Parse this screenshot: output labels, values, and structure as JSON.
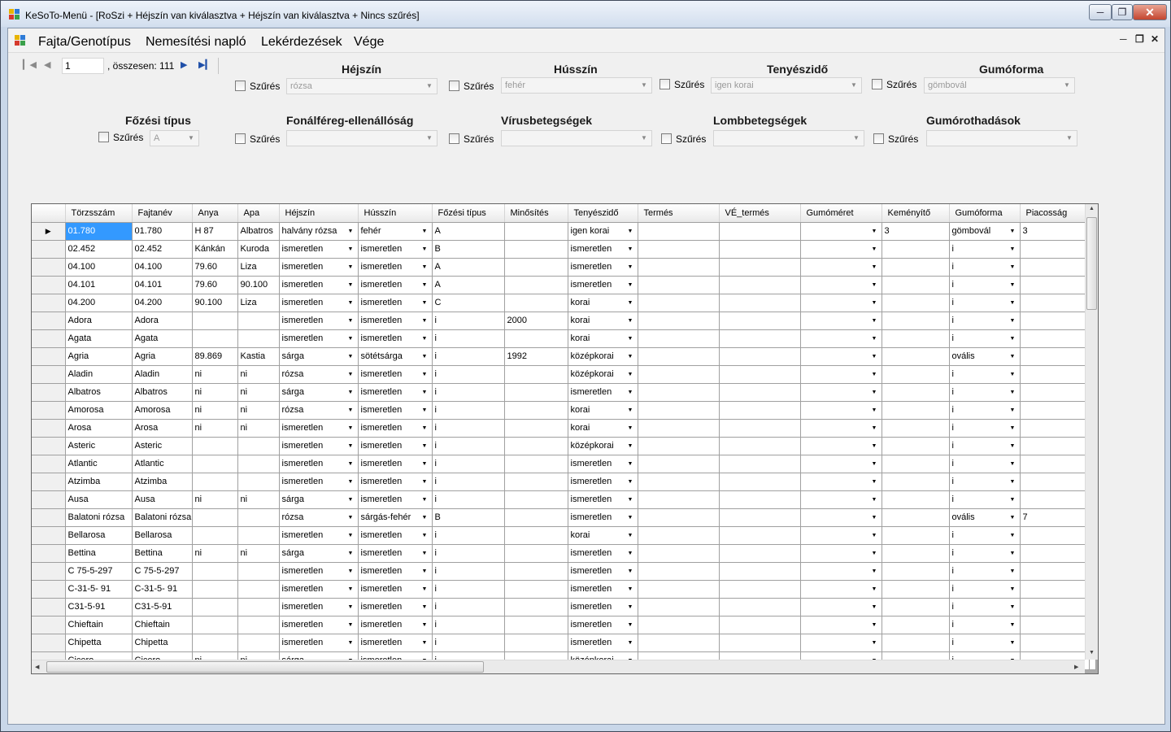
{
  "window": {
    "title": "KeSoTo-Menü - [RoSzi + Héjszín van kiválasztva + Héjszín van kiválasztva + Nincs szűrés]"
  },
  "menu": [
    "Fajta/Genotípus",
    "Nemesítési napló",
    "Lekérdezések",
    "Vége"
  ],
  "navigator": {
    "position": "1",
    "total": ", összesen: 111"
  },
  "filters": [
    {
      "title": "Héjszín",
      "label": "Szűrés",
      "value": "rózsa"
    },
    {
      "title": "Hússzín",
      "label": "Szűrés",
      "value": "fehér"
    },
    {
      "title": "Tenyészidő",
      "label": "Szűrés",
      "value": "igen korai"
    },
    {
      "title": "Gumóforma",
      "label": "Szűrés",
      "value": "gömbovál"
    },
    {
      "title": "Főzési típus",
      "label": "Szűrés",
      "value": "A"
    },
    {
      "title": "Fonálféreg-ellenállóság",
      "label": "Szűrés",
      "value": ""
    },
    {
      "title": "Vírusbetegségek",
      "label": "Szűrés",
      "value": ""
    },
    {
      "title": "Lombbetegségek",
      "label": "Szűrés",
      "value": ""
    },
    {
      "title": "Gumórothadások",
      "label": "Szűrés",
      "value": ""
    }
  ],
  "grid": {
    "columns": [
      "Törzsszám",
      "Fajtanév",
      "Anya",
      "Apa",
      "Héjszín",
      "Hússzín",
      "Főzési típus",
      "Minősítés",
      "Tenyészidő",
      "Termés",
      "VÉ_termés",
      "Gumóméret",
      "Keményítő",
      "Gumóforma",
      "Piacosság"
    ],
    "rows": [
      [
        "01.780",
        "01.780",
        "H 87",
        "Albatros",
        "halvány rózsa",
        "fehér",
        "A",
        "",
        "igen korai",
        "",
        "",
        "",
        "3",
        "gömbovál",
        "3"
      ],
      [
        "02.452",
        "02.452",
        "Kánkán",
        "Kuroda",
        "ismeretlen",
        "ismeretlen",
        "B",
        "",
        "ismeretlen",
        "",
        "",
        "",
        "",
        "i",
        ""
      ],
      [
        "04.100",
        "04.100",
        "79.60",
        "Liza",
        "ismeretlen",
        "ismeretlen",
        "A",
        "",
        "ismeretlen",
        "",
        "",
        "",
        "",
        "i",
        ""
      ],
      [
        "04.101",
        "04.101",
        "79.60",
        "90.100",
        "ismeretlen",
        "ismeretlen",
        "A",
        "",
        "ismeretlen",
        "",
        "",
        "",
        "",
        "i",
        ""
      ],
      [
        "04.200",
        "04.200",
        "90.100",
        "Liza",
        "ismeretlen",
        "ismeretlen",
        "C",
        "",
        "korai",
        "",
        "",
        "",
        "",
        "i",
        ""
      ],
      [
        "Adora",
        "Adora",
        "",
        "",
        "ismeretlen",
        "ismeretlen",
        "i",
        "2000",
        "korai",
        "",
        "",
        "",
        "",
        "i",
        ""
      ],
      [
        "Agata",
        "Agata",
        "",
        "",
        "ismeretlen",
        "ismeretlen",
        "i",
        "",
        "korai",
        "",
        "",
        "",
        "",
        "i",
        ""
      ],
      [
        "Agria",
        "Agria",
        "89.869",
        "Kastia",
        "sárga",
        "sötétsárga",
        "i",
        "1992",
        "középkorai",
        "",
        "",
        "",
        "",
        "ovális",
        ""
      ],
      [
        "Aladin",
        "Aladin",
        "ni",
        "ni",
        "rózsa",
        "ismeretlen",
        "i",
        "",
        "középkorai",
        "",
        "",
        "",
        "",
        "i",
        ""
      ],
      [
        "Albatros",
        "Albatros",
        "ni",
        "ni",
        "sárga",
        "ismeretlen",
        "i",
        "",
        "ismeretlen",
        "",
        "",
        "",
        "",
        "i",
        ""
      ],
      [
        "Amorosa",
        "Amorosa",
        "ni",
        "ni",
        "rózsa",
        "ismeretlen",
        "i",
        "",
        "korai",
        "",
        "",
        "",
        "",
        "i",
        ""
      ],
      [
        "Arosa",
        "Arosa",
        "ni",
        "ni",
        "ismeretlen",
        "ismeretlen",
        "i",
        "",
        "korai",
        "",
        "",
        "",
        "",
        "i",
        ""
      ],
      [
        "Asteric",
        "Asteric",
        "",
        "",
        "ismeretlen",
        "ismeretlen",
        "i",
        "",
        "középkorai",
        "",
        "",
        "",
        "",
        "i",
        ""
      ],
      [
        "Atlantic",
        "Atlantic",
        "",
        "",
        "ismeretlen",
        "ismeretlen",
        "i",
        "",
        "ismeretlen",
        "",
        "",
        "",
        "",
        "i",
        ""
      ],
      [
        "Atzimba",
        "Atzimba",
        "",
        "",
        "ismeretlen",
        "ismeretlen",
        "i",
        "",
        "ismeretlen",
        "",
        "",
        "",
        "",
        "i",
        ""
      ],
      [
        "Ausa",
        "Ausa",
        "ni",
        "ni",
        "sárga",
        "ismeretlen",
        "i",
        "",
        "ismeretlen",
        "",
        "",
        "",
        "",
        "i",
        ""
      ],
      [
        "Balatoni rózsa",
        "Balatoni rózsa",
        "",
        "",
        "rózsa",
        "sárgás-fehér",
        "B",
        "",
        "ismeretlen",
        "",
        "",
        "",
        "",
        "ovális",
        "7"
      ],
      [
        "Bellarosa",
        "Bellarosa",
        "",
        "",
        "ismeretlen",
        "ismeretlen",
        "i",
        "",
        "korai",
        "",
        "",
        "",
        "",
        "i",
        ""
      ],
      [
        "Bettina",
        "Bettina",
        "ni",
        "ni",
        "sárga",
        "ismeretlen",
        "i",
        "",
        "ismeretlen",
        "",
        "",
        "",
        "",
        "i",
        ""
      ],
      [
        "C 75-5-297",
        "C 75-5-297",
        "",
        "",
        "ismeretlen",
        "ismeretlen",
        "i",
        "",
        "ismeretlen",
        "",
        "",
        "",
        "",
        "i",
        ""
      ],
      [
        "C-31-5- 91",
        "C-31-5- 91",
        "",
        "",
        "ismeretlen",
        "ismeretlen",
        "i",
        "",
        "ismeretlen",
        "",
        "",
        "",
        "",
        "i",
        ""
      ],
      [
        "C31-5-91",
        "C31-5-91",
        "",
        "",
        "ismeretlen",
        "ismeretlen",
        "i",
        "",
        "ismeretlen",
        "",
        "",
        "",
        "",
        "i",
        ""
      ],
      [
        "Chieftain",
        "Chieftain",
        "",
        "",
        "ismeretlen",
        "ismeretlen",
        "i",
        "",
        "ismeretlen",
        "",
        "",
        "",
        "",
        "i",
        ""
      ],
      [
        "Chipetta",
        "Chipetta",
        "",
        "",
        "ismeretlen",
        "ismeretlen",
        "i",
        "",
        "ismeretlen",
        "",
        "",
        "",
        "",
        "i",
        ""
      ],
      [
        "Cicero",
        "Cicero",
        "ni",
        "ni",
        "sárga",
        "ismeretlen",
        "i",
        "",
        "középkorai",
        "",
        "",
        "",
        "",
        "i",
        ""
      ]
    ]
  }
}
